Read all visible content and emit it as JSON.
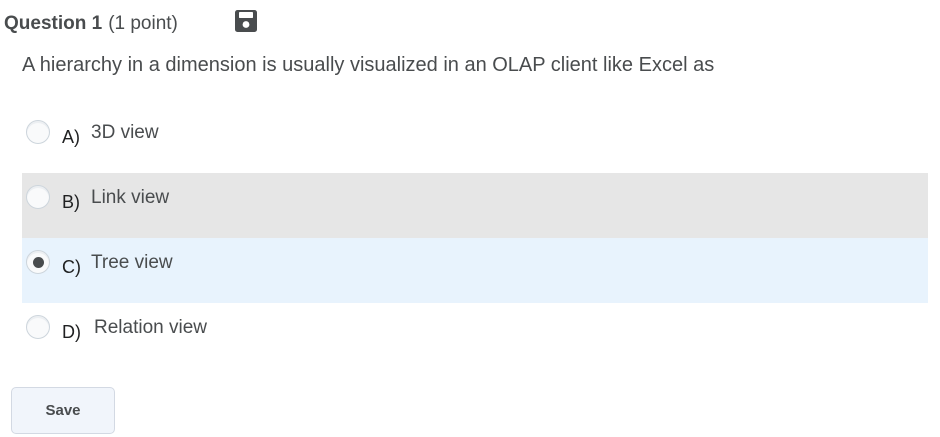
{
  "question": {
    "title": "Question 1",
    "points": "(1 point)",
    "save_icon": "floppy-disk-icon",
    "prompt": "A hierarchy in a dimension is usually visualized in an OLAP client like Excel as"
  },
  "choices": [
    {
      "letter": "A)",
      "text": "3D view",
      "selected": false
    },
    {
      "letter": "B)",
      "text": "Link view",
      "selected": false
    },
    {
      "letter": "C)",
      "text": "Tree view",
      "selected": true
    },
    {
      "letter": "D)",
      "text": "Relation view",
      "selected": false
    }
  ],
  "actions": {
    "save_label": "Save"
  },
  "colors": {
    "hover_row": "#e6e6e6",
    "selected_row": "#e8f3fd",
    "text": "#494c4e"
  }
}
